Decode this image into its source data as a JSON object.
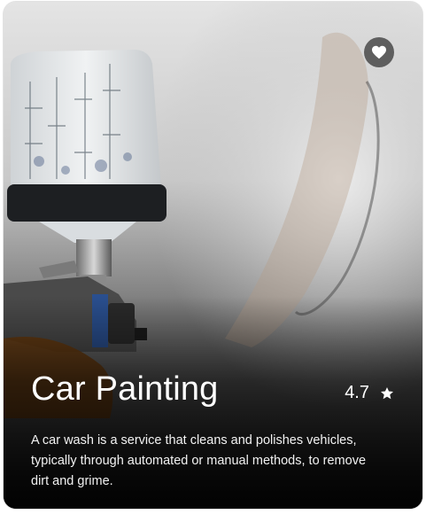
{
  "card": {
    "title": "Car Painting",
    "rating": "4.7",
    "description": "A car wash is a service that cleans and polishes vehicles, typically through automated or manual methods, to remove dirt and grime.",
    "favorite_icon": "heart-icon",
    "rating_icon": "star-icon"
  },
  "colors": {
    "text": "#ffffff",
    "fav_bg": "#3c3c3c"
  }
}
